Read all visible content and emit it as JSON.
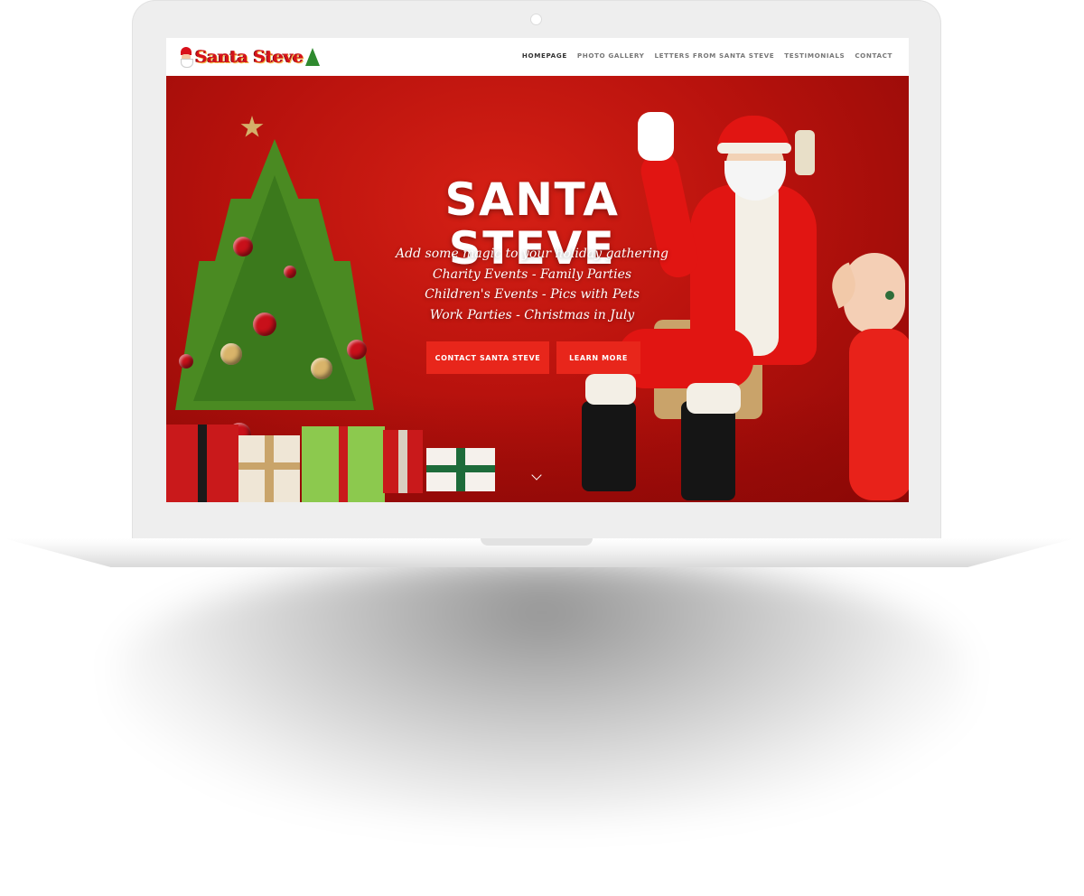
{
  "site": {
    "logo_text": "Santa Steve",
    "nav": [
      {
        "label": "HOMEPAGE",
        "active": true
      },
      {
        "label": "PHOTO GALLERY",
        "active": false
      },
      {
        "label": "LETTERS FROM SANTA STEVE",
        "active": false
      },
      {
        "label": "TESTIMONIALS",
        "active": false
      },
      {
        "label": "CONTACT",
        "active": false
      }
    ]
  },
  "hero": {
    "title": "SANTA STEVE",
    "taglines": [
      "Add some magic to your holiday gathering",
      "Charity Events - Family Parties",
      "Children's Events - Pics with Pets",
      "Work Parties - Christmas in July"
    ],
    "buttons": {
      "contact": "CONTACT SANTA STEVE",
      "learn": "LEARN MORE"
    },
    "scroll_icon": "chevron-down-icon"
  },
  "colors": {
    "hero_red": "#c0160f",
    "button_red": "#e8261b",
    "nav_text": "#777777",
    "nav_active": "#333333",
    "laptop_frame": "#eeeeee"
  }
}
